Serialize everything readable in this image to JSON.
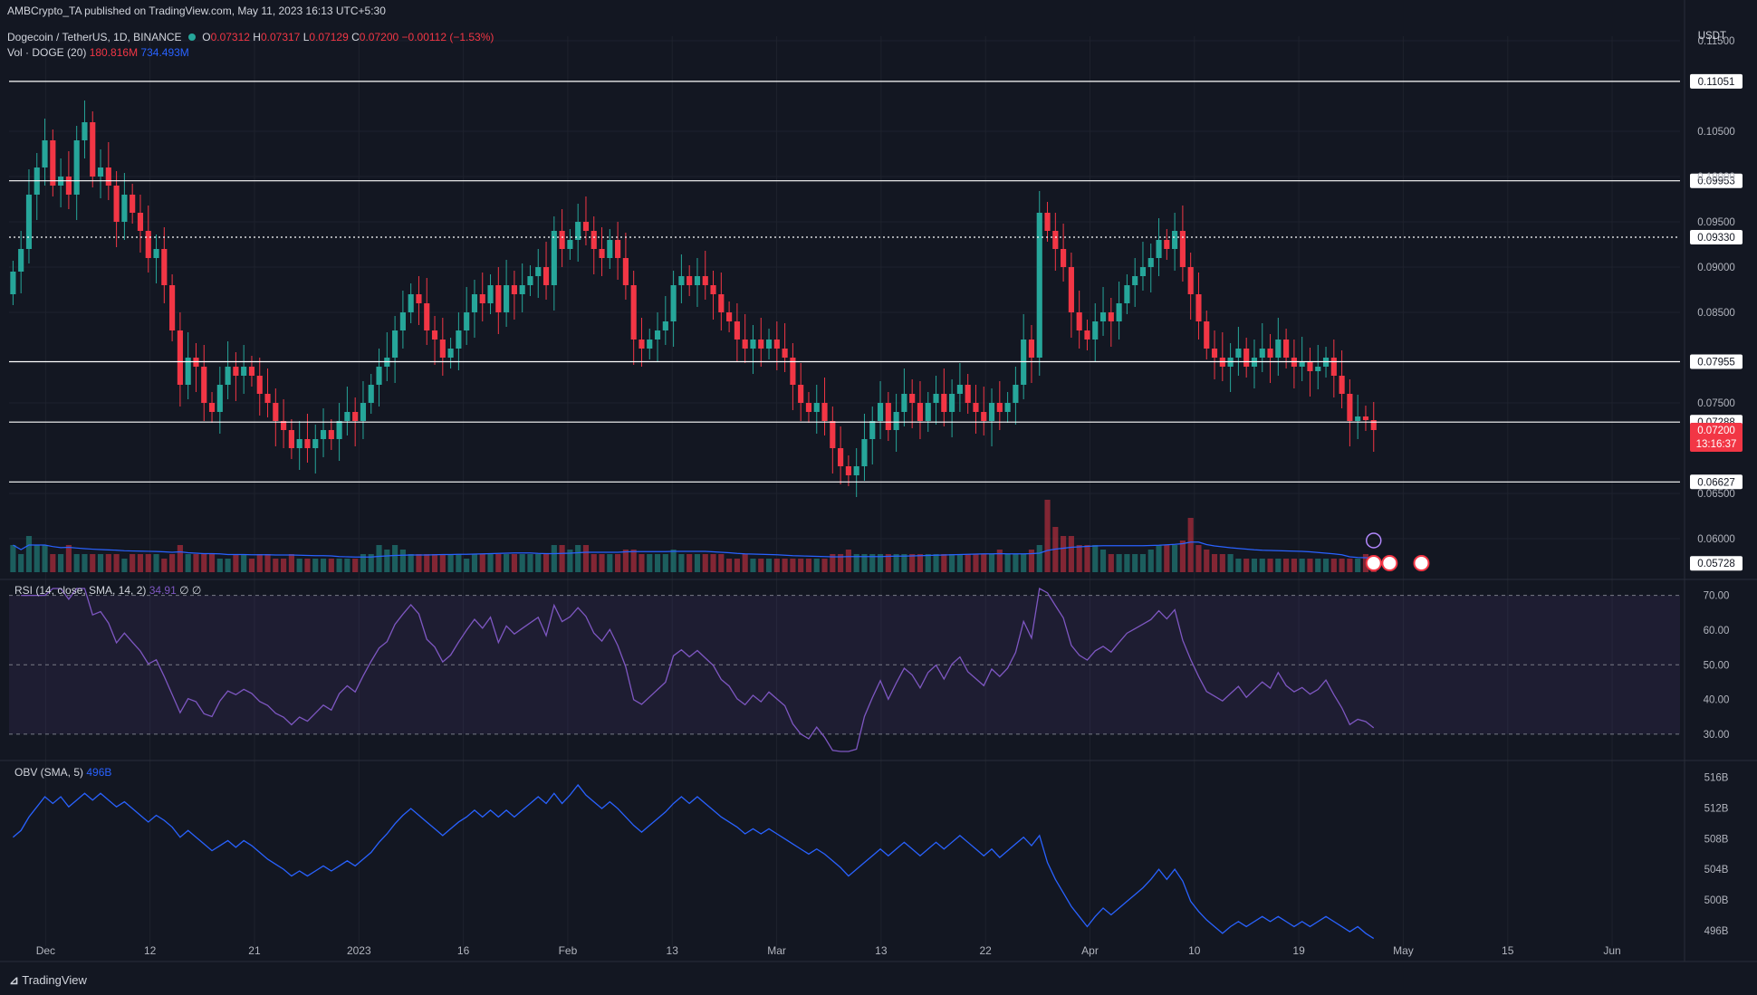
{
  "header": {
    "published": "AMBCrypto_TA published on TradingView.com, May 11, 2023 16:13 UTC+5:30",
    "symbol": "Dogecoin / TetherUS, 1D, BINANCE",
    "ohlc": {
      "o_label": "O",
      "o": "0.07312",
      "h_label": "H",
      "h": "0.07317",
      "l_label": "L",
      "l": "0.07129",
      "c_label": "C",
      "c": "0.07200",
      "change": "−0.00112 (−1.53%)"
    },
    "volume_label": "Vol · DOGE (20)",
    "volume_value": "180.816M",
    "volume_ma": "734.493M",
    "currency": "USDT"
  },
  "colors": {
    "up": "#26a69a",
    "down": "#f23645",
    "background": "#131722",
    "rsi": "#7e57c2",
    "obv": "#2962ff",
    "level": "#ffffff"
  },
  "footer": {
    "brand": "TradingView"
  },
  "chart_data": [
    {
      "type": "candlestick",
      "title": "Dogecoin / TetherUS, 1D, BINANCE",
      "ylim": [
        0.0565,
        0.1155
      ],
      "yticks": [
        "0.11500",
        "0.10500",
        "0.10000",
        "0.09500",
        "0.09000",
        "0.08500",
        "0.07500",
        "0.06500",
        "0.06000"
      ],
      "xticks": [
        "Dec",
        "12",
        "21",
        "2023",
        "16",
        "Feb",
        "13",
        "Mar",
        "13",
        "22",
        "Apr",
        "10",
        "19",
        "May",
        "15",
        "Jun"
      ],
      "levels": [
        {
          "label": "0.11051",
          "value": 0.11051,
          "style": "solid"
        },
        {
          "label": "0.09953",
          "value": 0.09953,
          "style": "solid"
        },
        {
          "label": "0.09330",
          "value": 0.0933,
          "style": "dotted"
        },
        {
          "label": "0.07955",
          "value": 0.07955,
          "style": "solid"
        },
        {
          "label": "0.07288",
          "value": 0.07288,
          "style": "solid"
        },
        {
          "label": "0.06627",
          "value": 0.06627,
          "style": "solid"
        },
        {
          "label": "0.05728",
          "value": 0.05728,
          "style": "none"
        }
      ],
      "last_price": {
        "label": "0.07200",
        "value": 0.072,
        "countdown": "13:16:37"
      },
      "close": [
        0.0895,
        0.092,
        0.098,
        0.101,
        0.104,
        0.099,
        0.1,
        0.098,
        0.104,
        0.106,
        0.1,
        0.101,
        0.099,
        0.095,
        0.098,
        0.096,
        0.094,
        0.091,
        0.092,
        0.088,
        0.083,
        0.077,
        0.08,
        0.079,
        0.075,
        0.074,
        0.077,
        0.079,
        0.078,
        0.079,
        0.078,
        0.076,
        0.075,
        0.073,
        0.072,
        0.07,
        0.071,
        0.07,
        0.071,
        0.072,
        0.071,
        0.073,
        0.074,
        0.073,
        0.075,
        0.077,
        0.079,
        0.08,
        0.083,
        0.085,
        0.087,
        0.086,
        0.083,
        0.082,
        0.08,
        0.081,
        0.083,
        0.085,
        0.087,
        0.086,
        0.088,
        0.085,
        0.088,
        0.087,
        0.088,
        0.089,
        0.09,
        0.088,
        0.094,
        0.092,
        0.093,
        0.095,
        0.094,
        0.092,
        0.091,
        0.093,
        0.091,
        0.088,
        0.082,
        0.081,
        0.082,
        0.083,
        0.084,
        0.088,
        0.089,
        0.088,
        0.089,
        0.088,
        0.087,
        0.085,
        0.084,
        0.082,
        0.081,
        0.082,
        0.081,
        0.082,
        0.081,
        0.08,
        0.077,
        0.075,
        0.074,
        0.075,
        0.073,
        0.07,
        0.068,
        0.067,
        0.068,
        0.071,
        0.073,
        0.075,
        0.072,
        0.074,
        0.076,
        0.075,
        0.073,
        0.075,
        0.076,
        0.074,
        0.076,
        0.077,
        0.075,
        0.074,
        0.073,
        0.075,
        0.074,
        0.075,
        0.077,
        0.082,
        0.08,
        0.096,
        0.094,
        0.092,
        0.09,
        0.085,
        0.083,
        0.082,
        0.084,
        0.085,
        0.084,
        0.086,
        0.088,
        0.089,
        0.09,
        0.091,
        0.093,
        0.092,
        0.094,
        0.09,
        0.087,
        0.084,
        0.081,
        0.08,
        0.079,
        0.08,
        0.081,
        0.079,
        0.08,
        0.081,
        0.08,
        0.082,
        0.08,
        0.079,
        0.0795,
        0.0785,
        0.079,
        0.08,
        0.078,
        0.076,
        0.073,
        0.0735,
        0.0731,
        0.072
      ],
      "series": [
        {
          "name": "Vol · DOGE (20)",
          "values": [
            3,
            2,
            4,
            3,
            3,
            2,
            2,
            3,
            2,
            2,
            2,
            2,
            2,
            2,
            1.5,
            2,
            2,
            2,
            2,
            1.5,
            2,
            3,
            2,
            2,
            2,
            2,
            1.5,
            1.5,
            2,
            2,
            1.5,
            2,
            2,
            1.5,
            1.5,
            2,
            1.5,
            1.5,
            1.5,
            1.5,
            1.5,
            1.5,
            1.5,
            1.5,
            2,
            2,
            3,
            2.5,
            3,
            2.5,
            2,
            2,
            2,
            2,
            2,
            2,
            2,
            1.5,
            2,
            2,
            2,
            2,
            2,
            2,
            2,
            2,
            2,
            2,
            3,
            3,
            2.5,
            3,
            3,
            2,
            2,
            2,
            2,
            2.5,
            2.5,
            2,
            2,
            2,
            2,
            2.5,
            2,
            2,
            2,
            2,
            2,
            2,
            1.5,
            1.5,
            2,
            1.5,
            1.5,
            1.5,
            1.5,
            1.5,
            1.5,
            1.5,
            1.5,
            1.5,
            1.5,
            2,
            2,
            2.5,
            2,
            2,
            2,
            2,
            2,
            2,
            2,
            2,
            2,
            2,
            2,
            2,
            2,
            2,
            2,
            2,
            2,
            2,
            2.5,
            2,
            2,
            2,
            2.5,
            3,
            8,
            5,
            4,
            4,
            3,
            3,
            3,
            2.5,
            2,
            2,
            2,
            2,
            2,
            2.5,
            3,
            3,
            3,
            3.5,
            6,
            3,
            2.5,
            2,
            2,
            2,
            1.5,
            1.5,
            1.5,
            1.5,
            1.5,
            1.5,
            1.5,
            1.5,
            1.5,
            1.5,
            1.5,
            1.5,
            1.5,
            1.5,
            1.5,
            1.5,
            2,
            1.5,
            1,
            0.8
          ]
        },
        {
          "name": "RSI (14, close, SMA, 14, 2)",
          "last": "34.91",
          "ylim": [
            25,
            72
          ],
          "yticks": [
            "70.00",
            "60.00",
            "50.00",
            "40.00",
            "30.00"
          ],
          "band": [
            30,
            70
          ],
          "mid": 50
        },
        {
          "name": "OBV (SMA, 5)",
          "last": "496B",
          "ylim": [
            494,
            517
          ],
          "yticks": [
            "516B",
            "512B",
            "508B",
            "504B",
            "500B",
            "496B"
          ]
        }
      ]
    }
  ]
}
